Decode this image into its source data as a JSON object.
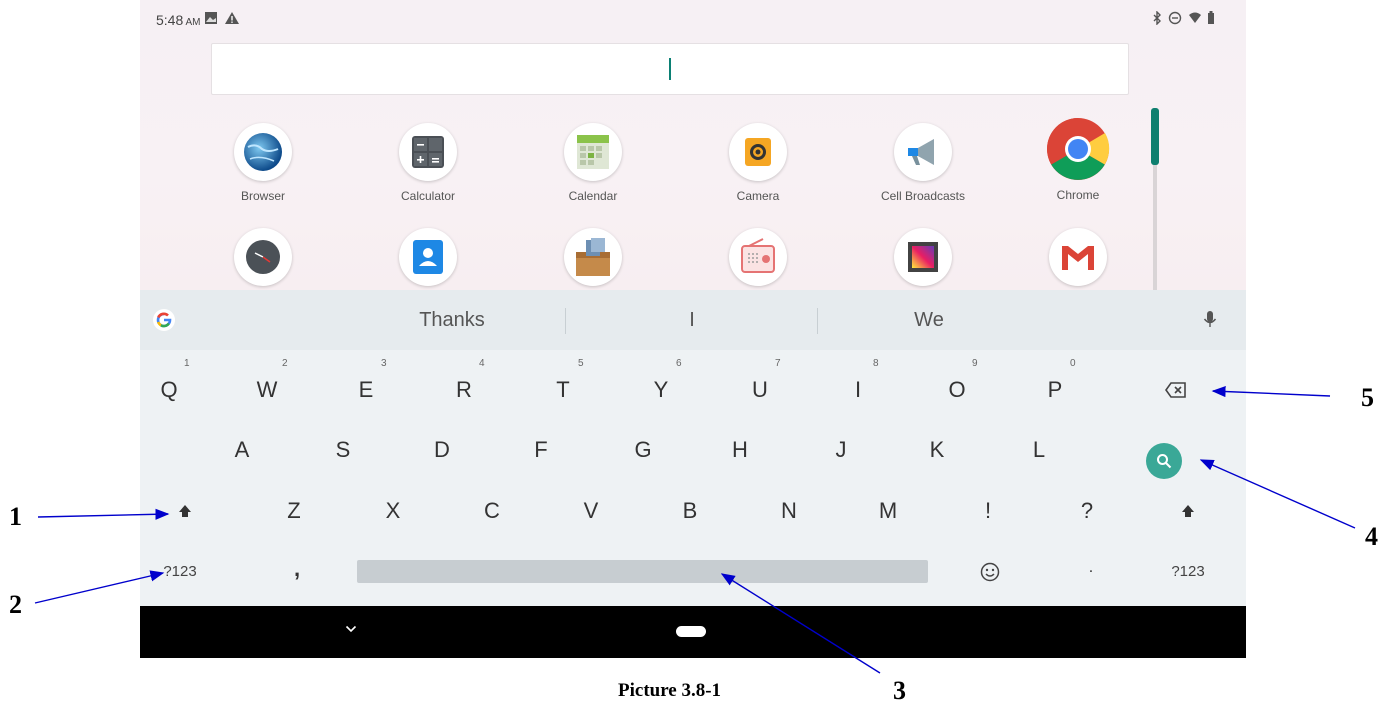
{
  "status_bar": {
    "time": "5:48",
    "ampm": "AM",
    "left_icons": [
      "image-icon",
      "warning-icon"
    ],
    "right_icons": [
      "bluetooth-icon",
      "dnd-icon",
      "wifi-icon",
      "battery-icon"
    ]
  },
  "search": {
    "value": ""
  },
  "apps_row1": [
    {
      "label": "Browser",
      "icon": "browser-icon"
    },
    {
      "label": "Calculator",
      "icon": "calculator-icon"
    },
    {
      "label": "Calendar",
      "icon": "calendar-icon"
    },
    {
      "label": "Camera",
      "icon": "camera-icon"
    },
    {
      "label": "Cell Broadcasts",
      "icon": "megaphone-icon"
    },
    {
      "label": "Chrome",
      "icon": "chrome-icon"
    }
  ],
  "apps_row2": [
    {
      "icon": "clock-icon"
    },
    {
      "icon": "contacts-icon"
    },
    {
      "icon": "file-manager-icon"
    },
    {
      "icon": "radio-icon"
    },
    {
      "icon": "gallery-icon"
    },
    {
      "icon": "gmail-icon"
    }
  ],
  "suggestions": [
    "Thanks",
    "I",
    "We"
  ],
  "keyboard": {
    "row1": [
      {
        "k": "Q",
        "n": "1"
      },
      {
        "k": "W",
        "n": "2"
      },
      {
        "k": "E",
        "n": "3"
      },
      {
        "k": "R",
        "n": "4"
      },
      {
        "k": "T",
        "n": "5"
      },
      {
        "k": "Y",
        "n": "6"
      },
      {
        "k": "U",
        "n": "7"
      },
      {
        "k": "I",
        "n": "8"
      },
      {
        "k": "O",
        "n": "9"
      },
      {
        "k": "P",
        "n": "0"
      }
    ],
    "row2": [
      "A",
      "S",
      "D",
      "F",
      "G",
      "H",
      "J",
      "K",
      "L"
    ],
    "row3": [
      "Z",
      "X",
      "C",
      "V",
      "B",
      "N",
      "M",
      "!",
      "?"
    ],
    "sym_left": "?123",
    "comma": ",",
    "period": ".",
    "sym_right": "?123"
  },
  "callouts": [
    "1",
    "2",
    "3",
    "4",
    "5"
  ],
  "caption": "Picture 3.8-1",
  "colors": {
    "accent": "#0f7f6f",
    "search_key": "#3aa897",
    "arrow": "#0000cc"
  }
}
